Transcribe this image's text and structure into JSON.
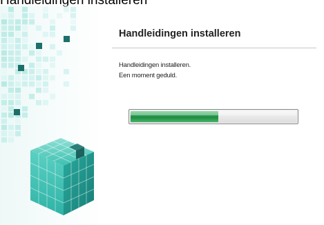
{
  "window": {
    "top_caption": "Handleidingen installeren"
  },
  "main": {
    "heading": "Handleidingen installeren",
    "message_line_1": "Handleidingen installeren.",
    "message_line_2": "Een moment geduld."
  },
  "progress": {
    "value": 0.53,
    "fill_color": "#2a9a4f"
  },
  "art": {
    "icon": "cube-blocks-art",
    "accent_color": "#2fb9a8"
  }
}
